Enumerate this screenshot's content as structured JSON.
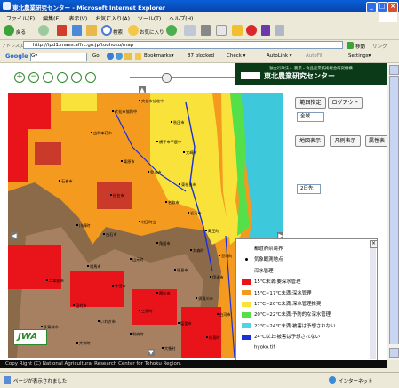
{
  "window": {
    "title": "東北農業研究センター - Microsoft Internet Explorer",
    "min_label": "_",
    "max_label": "□",
    "close_label": "×"
  },
  "menu": {
    "items": [
      "ファイル(F)",
      "編集(E)",
      "表示(V)",
      "お気に入り(A)",
      "ツール(T)",
      "ヘルプ(H)"
    ]
  },
  "toolbar": {
    "back_label": "戻る",
    "search_label": "検索",
    "favorites_label": "お気に入り"
  },
  "address": {
    "label": "アドレス(D)",
    "url": "http://ipd1.maes.affrc.go.jp/touhoku/map",
    "go_label": "移動",
    "links_label": "リンク"
  },
  "google": {
    "logo": "Google",
    "search_placeholder": "G▾",
    "go_label": "Go",
    "bookmarks_label": "Bookmarks▾",
    "blocked_label": "87 blocked",
    "check_label": "Check ▾",
    "autolink_label": "AutoLink ▾",
    "autofill_label": "AutoFill",
    "settings_label": "Settings▾"
  },
  "header": {
    "banner_small": "独立行政法人 農業・食品産業技術総合研究機構",
    "banner_title": "東北農業研究センター"
  },
  "panel": {
    "range_button": "範囲指定",
    "logout_button": "ログアウト",
    "area_select": "全域",
    "map_button": "地図表示",
    "legend_button": "凡例表示",
    "attr_button": "属性表",
    "date_select": "2日先"
  },
  "legend": {
    "rows": [
      {
        "label": "都道府県境界",
        "color": "#ffffff"
      },
      {
        "label": "気象観測地点",
        "color": "#000000"
      },
      {
        "label": "深水管理",
        "color": "#ffffff"
      },
      {
        "label": "15℃未満:要深水管理",
        "color": "#e8141a"
      },
      {
        "label": "15℃~17℃未満:深水管理",
        "color": "#f39a1f"
      },
      {
        "label": "17℃~20℃未満:深水管理推奨",
        "color": "#f9e23a"
      },
      {
        "label": "20℃~22℃未満:予防的な深水管理",
        "color": "#55e04a"
      },
      {
        "label": "22℃~24℃未満:被害は予想されない",
        "color": "#4ad6e8"
      },
      {
        "label": "24℃以上:被害は予想されない",
        "color": "#1b2fd8"
      },
      {
        "label": "hyoko.tif",
        "color": "#ffffff"
      }
    ]
  },
  "map": {
    "logo": "JWA",
    "place_labels": [
      "大仙市仙北中",
      "大仙市協和中",
      "秋田市",
      "由利本荘市",
      "横手市平鹿中",
      "大崎市",
      "栗原市",
      "登米市",
      "石巻市",
      "東松島市",
      "仙台市",
      "名取市",
      "岩沼市",
      "村田町立",
      "川崎町",
      "蔵王町",
      "白石市",
      "角田市",
      "丸森町",
      "亘理町",
      "山元町",
      "相馬市",
      "福島市",
      "伊達市",
      "二本松市",
      "本宮市",
      "郡山市",
      "須賀川市",
      "田村市",
      "三春町",
      "白河市",
      "いわき市",
      "塩釜市",
      "多賀城市",
      "利府町",
      "松島町",
      "大和町",
      "大衡村"
    ]
  },
  "footer": {
    "copyright": "Copy Right (C) National Agricultural Research Center for Tohoku Region."
  },
  "status": {
    "text": "ページが表示されました",
    "zone": "インターネット"
  }
}
